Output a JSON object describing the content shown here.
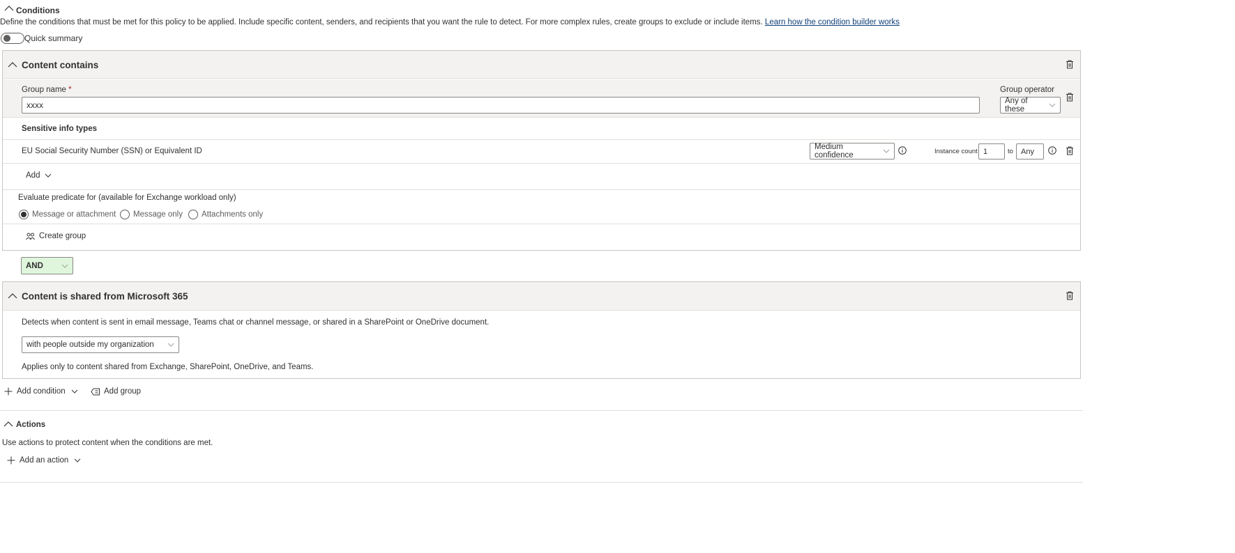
{
  "conditions": {
    "title": "Conditions",
    "description": "Define the conditions that must be met for this policy to be applied. Include specific content, senders, and recipients that you want the rule to detect. For more complex rules, create groups to exclude or include items.",
    "learn_link": "Learn how the condition builder works",
    "quick_summary_label": "Quick summary",
    "quick_summary_on": false
  },
  "content_contains": {
    "title": "Content contains",
    "group_name_label": "Group name",
    "required_mark": "*",
    "group_name_value": "xxxx",
    "group_operator_label": "Group operator",
    "group_operator_value": "Any of these",
    "sensitive_info_header": "Sensitive info types",
    "sit": {
      "name": "EU Social Security Number (SSN) or Equivalent ID",
      "confidence": "Medium confidence",
      "instance_count_label": "Instance count",
      "instance_min": "1",
      "to_label": "to",
      "instance_max": "Any"
    },
    "add_label": "Add",
    "evaluate_label": "Evaluate predicate for (available for Exchange workload only)",
    "radio_options": [
      {
        "label": "Message or attachment",
        "checked": true
      },
      {
        "label": "Message only",
        "checked": false
      },
      {
        "label": "Attachments only",
        "checked": false
      }
    ],
    "create_group_label": "Create group"
  },
  "operator": {
    "value": "AND",
    "bg_color": "#dff6dd"
  },
  "shared": {
    "title": "Content is shared from Microsoft 365",
    "description": "Detects when content is sent in email message, Teams chat or channel message, or shared in a SharePoint or OneDrive document.",
    "select_value": "with people outside my organization",
    "note": "Applies only to content shared from Exchange, SharePoint, OneDrive, and Teams."
  },
  "footer": {
    "add_condition_label": "Add condition",
    "add_group_label": "Add group"
  },
  "actions": {
    "title": "Actions",
    "description": "Use actions to protect content when the conditions are met.",
    "add_action_label": "Add an action"
  },
  "colors": {
    "link": "#0f3f7a",
    "header_bg": "#f3f2f1",
    "border": "#c8c6c4",
    "required": "#a4262c"
  }
}
